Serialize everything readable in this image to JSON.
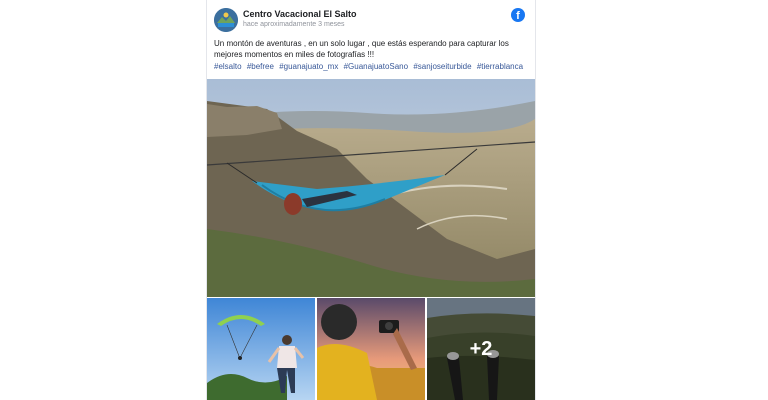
{
  "post": {
    "page_name": "Centro Vacacional El Salto",
    "timestamp": "hace aproximadamente 3 meses",
    "text": "Un montón de aventuras , en un solo lugar , que estás esperando para capturar los mejores momentos en miles de fotografías !!!",
    "hashtags": [
      "#elsalto",
      "#befree",
      "#guanajuato_mx",
      "#GuanajuatoSano",
      "#sanjoseiturbide",
      "#tierrablanca"
    ],
    "facebook_icon": "facebook-icon",
    "more_photos": "+2",
    "colors": {
      "hashtag": "#385898",
      "facebook": "#1877f2"
    }
  }
}
